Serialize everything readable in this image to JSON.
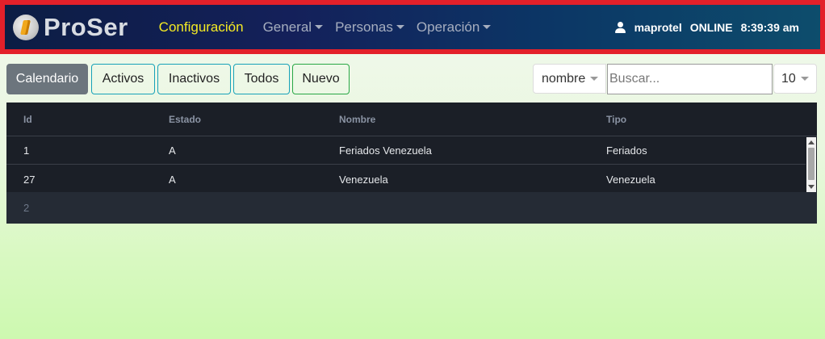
{
  "header": {
    "app_name": "ProSer",
    "nav": [
      {
        "label": "Configuración",
        "active": true,
        "dropdown": false
      },
      {
        "label": "General",
        "active": false,
        "dropdown": true
      },
      {
        "label": "Personas",
        "active": false,
        "dropdown": true
      },
      {
        "label": "Operación",
        "active": false,
        "dropdown": true
      }
    ],
    "user": "maprotel",
    "status": "ONLINE",
    "time": "8:39:39 am",
    "colors": {
      "border": "#e3202a",
      "active_link": "#f4ea24",
      "link": "#a6aebf"
    }
  },
  "toolbar": {
    "buttons": [
      {
        "label": "Calendario"
      },
      {
        "label": "Activos"
      },
      {
        "label": "Inactivos"
      },
      {
        "label": "Todos"
      },
      {
        "label": "Nuevo"
      }
    ],
    "field_select": "nombre",
    "search_placeholder": "Buscar...",
    "search_value": "",
    "page_size": "10"
  },
  "table": {
    "columns": [
      "Id",
      "Estado",
      "Nombre",
      "Tipo"
    ],
    "rows": [
      {
        "id": "1",
        "estado": "A",
        "nombre": "Feriados Venezuela",
        "tipo": "Feriados"
      },
      {
        "id": "27",
        "estado": "A",
        "nombre": "Venezuela",
        "tipo": "Venezuela"
      }
    ],
    "footer_count": "2"
  }
}
